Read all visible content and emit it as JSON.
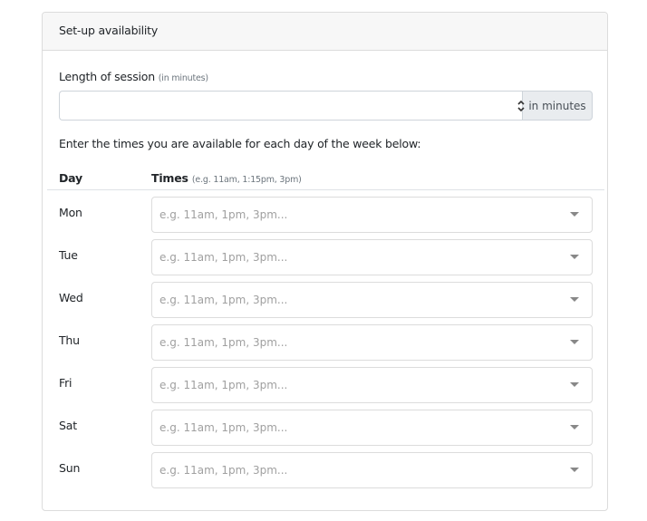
{
  "card": {
    "title": "Set-up availability"
  },
  "session": {
    "label": "Length of session",
    "label_hint": "(in minutes)",
    "value": "",
    "addon": "in minutes"
  },
  "instruction": "Enter the times you are available for each day of the week below:",
  "table": {
    "day_header": "Day",
    "times_header": "Times",
    "times_hint": "(e.g. 11am, 1:15pm, 3pm)",
    "placeholder": "e.g. 11am, 1pm, 3pm...",
    "rows": [
      {
        "day": "Mon"
      },
      {
        "day": "Tue"
      },
      {
        "day": "Wed"
      },
      {
        "day": "Thu"
      },
      {
        "day": "Fri"
      },
      {
        "day": "Sat"
      },
      {
        "day": "Sun"
      }
    ]
  }
}
